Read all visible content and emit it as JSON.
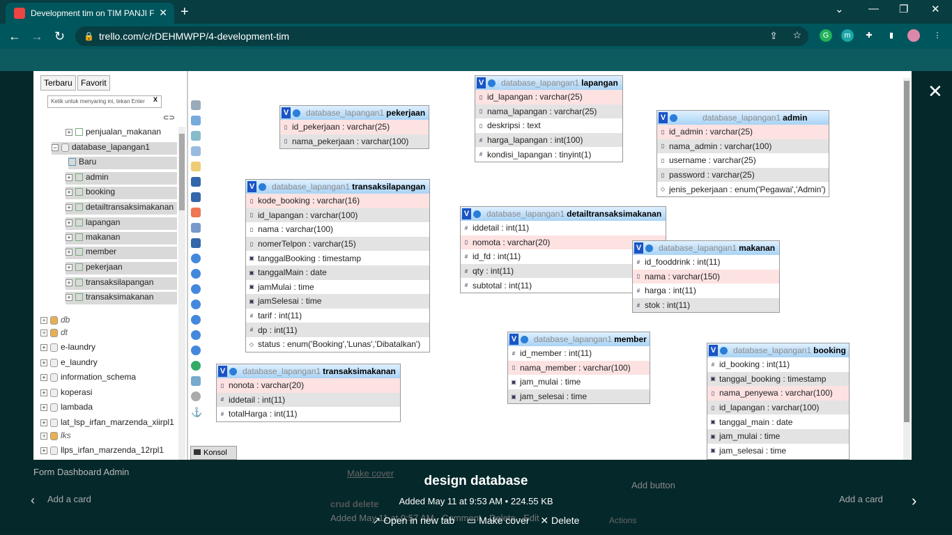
{
  "browser": {
    "tab_title": "Development tim on TIM PANJI F",
    "url": "trello.com/c/rDEHMWPP/4-development-tim"
  },
  "background": {
    "form_dashboard": "Form Dashboard Admin",
    "add_card_left": "Add a card",
    "add_card_right": "Add a card",
    "make_cover_bg": "Make cover",
    "add_button": "Add button",
    "crud_delete": "crud delete",
    "added_bg": "Added May 11 at 9:57 AM - Comment - Delete - Edit",
    "actions": "Actions"
  },
  "attachment": {
    "title": "design database",
    "meta": "Added May 11 at 9:53 AM • 224.55 KB",
    "open_new_tab": "Open in new tab",
    "make_cover": "Make cover",
    "delete": "Delete"
  },
  "left_panel": {
    "tab_recent": "Terbaru",
    "tab_favorite": "Favorit",
    "filter_placeholder": "Ketik untuk menyaring ini, tekan Enter",
    "tree": [
      "penjualan_makanan",
      "database_lapangan1",
      "Baru",
      "admin",
      "booking",
      "detailtransaksimakanan",
      "lapangan",
      "makanan",
      "member",
      "pekerjaan",
      "transaksilapangan",
      "transaksimakanan",
      "db",
      "dt",
      "e-laundry",
      "e_laundry",
      "information_schema",
      "koperasi",
      "lambada",
      "lat_lsp_irfan_marzenda_xiirpl1",
      "lks",
      "llps_irfan_marzenda_12rpl1"
    ],
    "console": "Konsol"
  },
  "db_prefix": "database_lapangan1",
  "tables": {
    "pekerjaan": {
      "name": "pekerjaan",
      "rows": [
        "id_pekerjaan : varchar(25)",
        "nama_pekerjaan : varchar(100)"
      ]
    },
    "lapangan": {
      "name": "lapangan",
      "rows": [
        "id_lapangan : varchar(25)",
        "nama_lapangan : varchar(25)",
        "deskripsi : text",
        "harga_lapangan : int(100)",
        "kondisi_lapangan : tinyint(1)"
      ]
    },
    "admin": {
      "name": "admin",
      "rows": [
        "id_admin : varchar(25)",
        "nama_admin : varchar(100)",
        "username : varchar(25)",
        "password : varchar(25)",
        "jenis_pekerjaan : enum('Pegawai','Admin')"
      ]
    },
    "transaksilapangan": {
      "name": "transaksilapangan",
      "rows": [
        "kode_booking : varchar(16)",
        "id_lapangan : varchar(100)",
        "nama : varchar(100)",
        "nomerTelpon : varchar(15)",
        "tanggalBooking : timestamp",
        "tanggalMain : date",
        "jamMulai : time",
        "jamSelesai : time",
        "tarif : int(11)",
        "dp : int(11)",
        "status : enum('Booking','Lunas','Dibatalkan')"
      ]
    },
    "detailtransaksimakanan": {
      "name": "detailtransaksimakanan",
      "rows": [
        "iddetail : int(11)",
        "nomota : varchar(20)",
        "id_fd : int(11)",
        "qty : int(11)",
        "subtotal : int(11)"
      ]
    },
    "makanan": {
      "name": "makanan",
      "rows": [
        "id_fooddrink : int(11)",
        "nama : varchar(150)",
        "harga : int(11)",
        "stok : int(11)"
      ]
    },
    "transaksimakanan": {
      "name": "transaksimakanan",
      "rows": [
        "nonota : varchar(20)",
        "iddetail : int(11)",
        "totalHarga : int(11)"
      ]
    },
    "member": {
      "name": "member",
      "rows": [
        "id_member : int(11)",
        "nama_member : varchar(100)",
        "jam_mulai : time",
        "jam_selesai : time"
      ]
    },
    "booking": {
      "name": "booking",
      "rows": [
        "id_booking : int(11)",
        "tanggal_booking : timestamp",
        "nama_penyewa : varchar(100)",
        "id_lapangan : varchar(100)",
        "tanggal_main : date",
        "jam_mulai : time",
        "jam_selesai : time"
      ]
    }
  }
}
